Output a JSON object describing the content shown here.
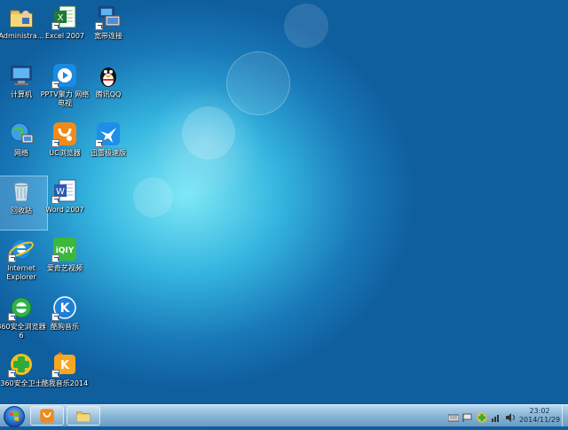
{
  "desktop": {
    "icons": [
      {
        "label": "Administra..."
      },
      {
        "label": "Excel 2007"
      },
      {
        "label": "宽带连接"
      },
      {
        "label": "计算机"
      },
      {
        "label": "PPTV聚力 网络电视"
      },
      {
        "label": "腾讯QQ"
      },
      {
        "label": "网络"
      },
      {
        "label": "UC浏览器"
      },
      {
        "label": "迅雷极速版"
      },
      {
        "label": "回收站"
      },
      {
        "label": "Word 2007"
      },
      {
        "label": "Internet Explorer"
      },
      {
        "label": "爱奇艺视频"
      },
      {
        "label": "360安全浏览器6"
      },
      {
        "label": "酷狗音乐"
      },
      {
        "label": "360安全卫士"
      },
      {
        "label": "酷我音乐2014"
      }
    ]
  },
  "taskbar": {
    "clock_time": "23:02",
    "clock_date": "2014/11/29"
  }
}
